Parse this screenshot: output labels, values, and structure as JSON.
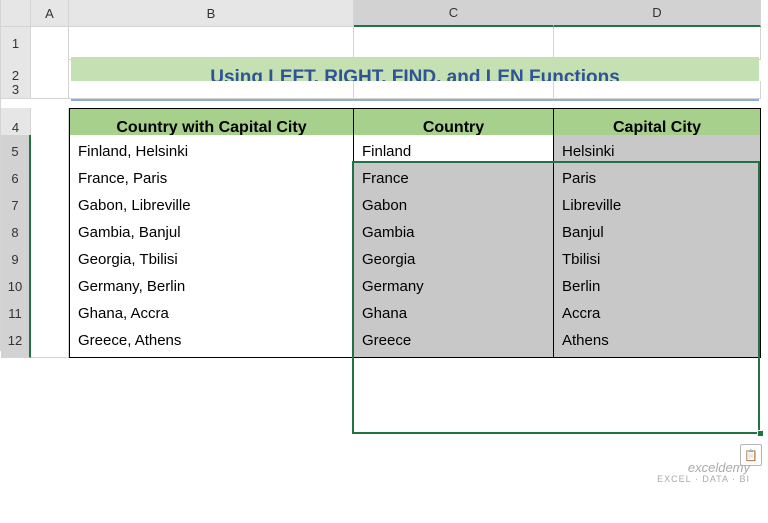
{
  "columns": [
    "A",
    "B",
    "C",
    "D"
  ],
  "rows": [
    "1",
    "2",
    "3",
    "4",
    "5",
    "6",
    "7",
    "8",
    "9",
    "10",
    "11",
    "12"
  ],
  "title": "Using LEFT, RIGHT, FIND, and LEN Functions",
  "headers": {
    "combined": "Country with Capital City",
    "country": "Country",
    "capital": "Capital City"
  },
  "chart_data": {
    "type": "table",
    "title": "Using LEFT, RIGHT, FIND, and LEN Functions",
    "columns": [
      "Country with Capital City",
      "Country",
      "Capital City"
    ],
    "rows": [
      {
        "combined": "Finland, Helsinki",
        "country": "Finland",
        "capital": "Helsinki"
      },
      {
        "combined": "France, Paris",
        "country": "France",
        "capital": "Paris"
      },
      {
        "combined": "Gabon, Libreville",
        "country": "Gabon",
        "capital": "Libreville"
      },
      {
        "combined": "Gambia, Banjul",
        "country": "Gambia",
        "capital": "Banjul"
      },
      {
        "combined": "Georgia, Tbilisi",
        "country": "Georgia",
        "capital": "Tbilisi"
      },
      {
        "combined": "Germany, Berlin",
        "country": "Germany",
        "capital": "Berlin"
      },
      {
        "combined": "Ghana, Accra",
        "country": "Ghana",
        "capital": "Accra"
      },
      {
        "combined": "Greece, Athens",
        "country": "Greece",
        "capital": "Athens"
      }
    ]
  },
  "watermark": {
    "main": "exceldemy",
    "sub": "EXCEL · DATA · BI"
  }
}
